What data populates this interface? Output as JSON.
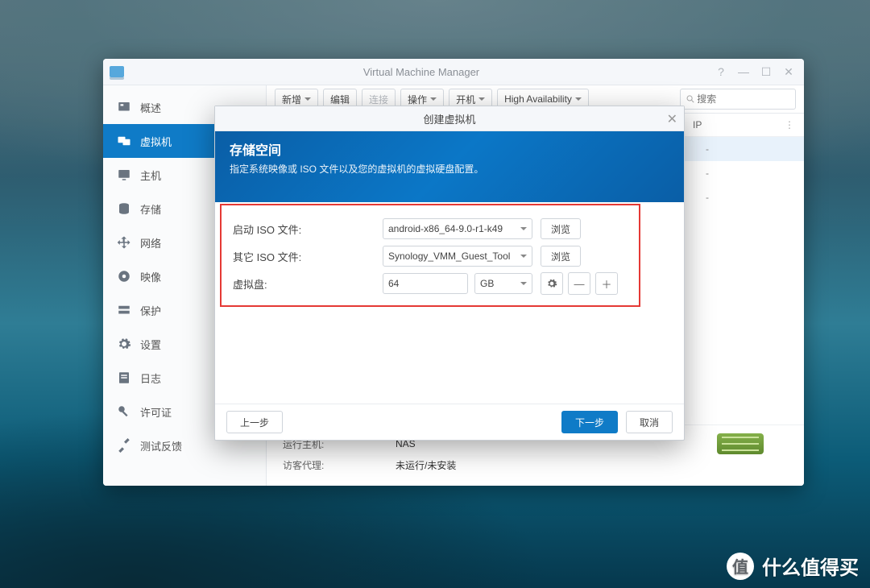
{
  "window": {
    "title": "Virtual Machine Manager"
  },
  "sidebar": {
    "items": [
      {
        "label": "概述"
      },
      {
        "label": "虚拟机"
      },
      {
        "label": "主机"
      },
      {
        "label": "存储"
      },
      {
        "label": "网络"
      },
      {
        "label": "映像"
      },
      {
        "label": "保护"
      },
      {
        "label": "设置"
      },
      {
        "label": "日志"
      },
      {
        "label": "许可证"
      },
      {
        "label": "测试反馈"
      }
    ]
  },
  "toolbar": {
    "add": "新增",
    "edit": "编辑",
    "connect": "连接",
    "action": "操作",
    "power": "开机",
    "ha": "High Availability",
    "search_ph": "搜索"
  },
  "list": {
    "col_ip": "IP",
    "rows": [
      {
        "ip": "-"
      },
      {
        "ip": "-"
      },
      {
        "ip": "-"
      }
    ]
  },
  "detail": {
    "host_label": "运行主机:",
    "host_value": "NAS",
    "agent_label": "访客代理:",
    "agent_value": "未运行/未安装"
  },
  "modal": {
    "title": "创建虚拟机",
    "banner_title": "存储空间",
    "banner_sub": "指定系统映像或 ISO 文件以及您的虚拟机的虚拟硬盘配置。",
    "boot_iso_label": "启动 ISO 文件:",
    "boot_iso_value": "android-x86_64-9.0-r1-k49",
    "other_iso_label": "其它 ISO 文件:",
    "other_iso_value": "Synology_VMM_Guest_Tool",
    "browse": "浏览",
    "vdisk_label": "虚拟盘:",
    "vdisk_size": "64",
    "vdisk_unit": "GB",
    "prev": "上一步",
    "next": "下一步",
    "cancel": "取消"
  },
  "watermark": "什么值得买"
}
